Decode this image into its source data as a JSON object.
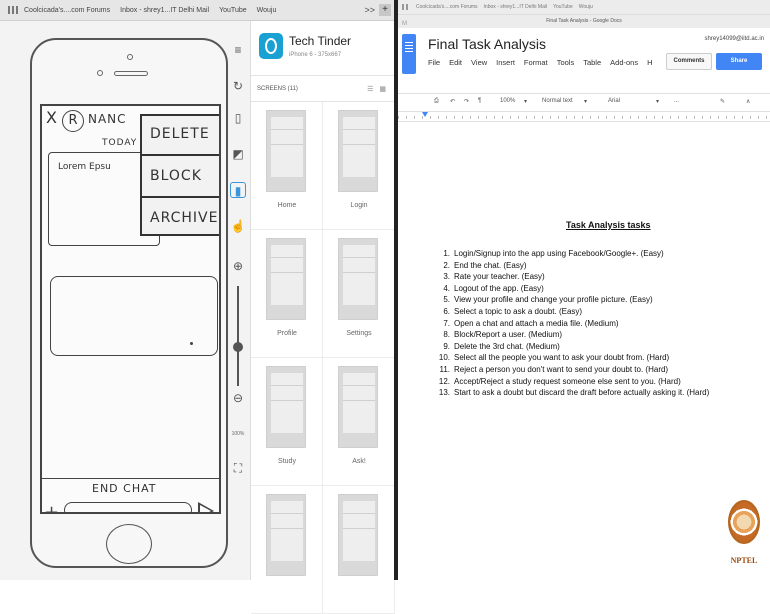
{
  "left_bookmarks": [
    "Coolcicada's....com Forums",
    "Inbox - shrey1...IT Delhi Mail",
    "YouTube",
    "Wouju"
  ],
  "left_more": ">>",
  "left_plus": "+",
  "sketch": {
    "close": "X",
    "avatar_letter": "R",
    "name": "NANC",
    "today": "TODAY I",
    "lorem": "Lorem Epsu",
    "menu": [
      "DELETE",
      "BLOCK",
      "ARCHIVE"
    ],
    "end_chat": "END CHAT",
    "plus": "+"
  },
  "toolbar_zoom": "100%",
  "app": {
    "title": "Tech Tinder",
    "subtitle": "iPhone 6 - 375x667",
    "screens_label": "SCREENS (11)",
    "screens": [
      {
        "label": "Home"
      },
      {
        "label": "Login"
      },
      {
        "label": "Profile"
      },
      {
        "label": "Settings"
      },
      {
        "label": "Study"
      },
      {
        "label": "Ask!"
      },
      {
        "label": ""
      },
      {
        "label": ""
      }
    ]
  },
  "right_bookmarks": [
    "Coolcicada's....com Forums",
    "Inbox - shrey1...IT Delhi Mail",
    "YouTube",
    "Wouju"
  ],
  "tab_title": "Final Task Analysis - Google Docs",
  "doc": {
    "title": "Final Task Analysis",
    "user": "shrey14099@iitd.ac.in",
    "menu": [
      "File",
      "Edit",
      "View",
      "Insert",
      "Format",
      "Tools",
      "Table",
      "Add-ons",
      "H"
    ],
    "comments": "Comments",
    "share": "Share",
    "toolbar": {
      "zoom": "100%",
      "style": "Normal text",
      "font": "Arial",
      "more": "..."
    },
    "heading": "Task Analysis tasks",
    "tasks": [
      "Login/Signup into the app using Facebook/Google+. (Easy)",
      "End the chat. (Easy)",
      "Rate your teacher. (Easy)",
      "Logout of the app. (Easy)",
      "View your profile and change your profile picture. (Easy)",
      "Select a topic to ask a doubt. (Easy)",
      "Open a chat and attach a media file. (Medium)",
      "Block/Report a user. (Medium)",
      "Delete the 3rd chat. (Medium)",
      "Select all the people you want to ask your doubt from. (Hard)",
      "Reject a person you don't want to send your doubt to. (Hard)",
      "Accept/Reject a study request someone else sent to you. (Hard)",
      "Start to ask a doubt but discard the draft before actually asking it. (Hard)"
    ]
  },
  "watermark": "NPTEL"
}
